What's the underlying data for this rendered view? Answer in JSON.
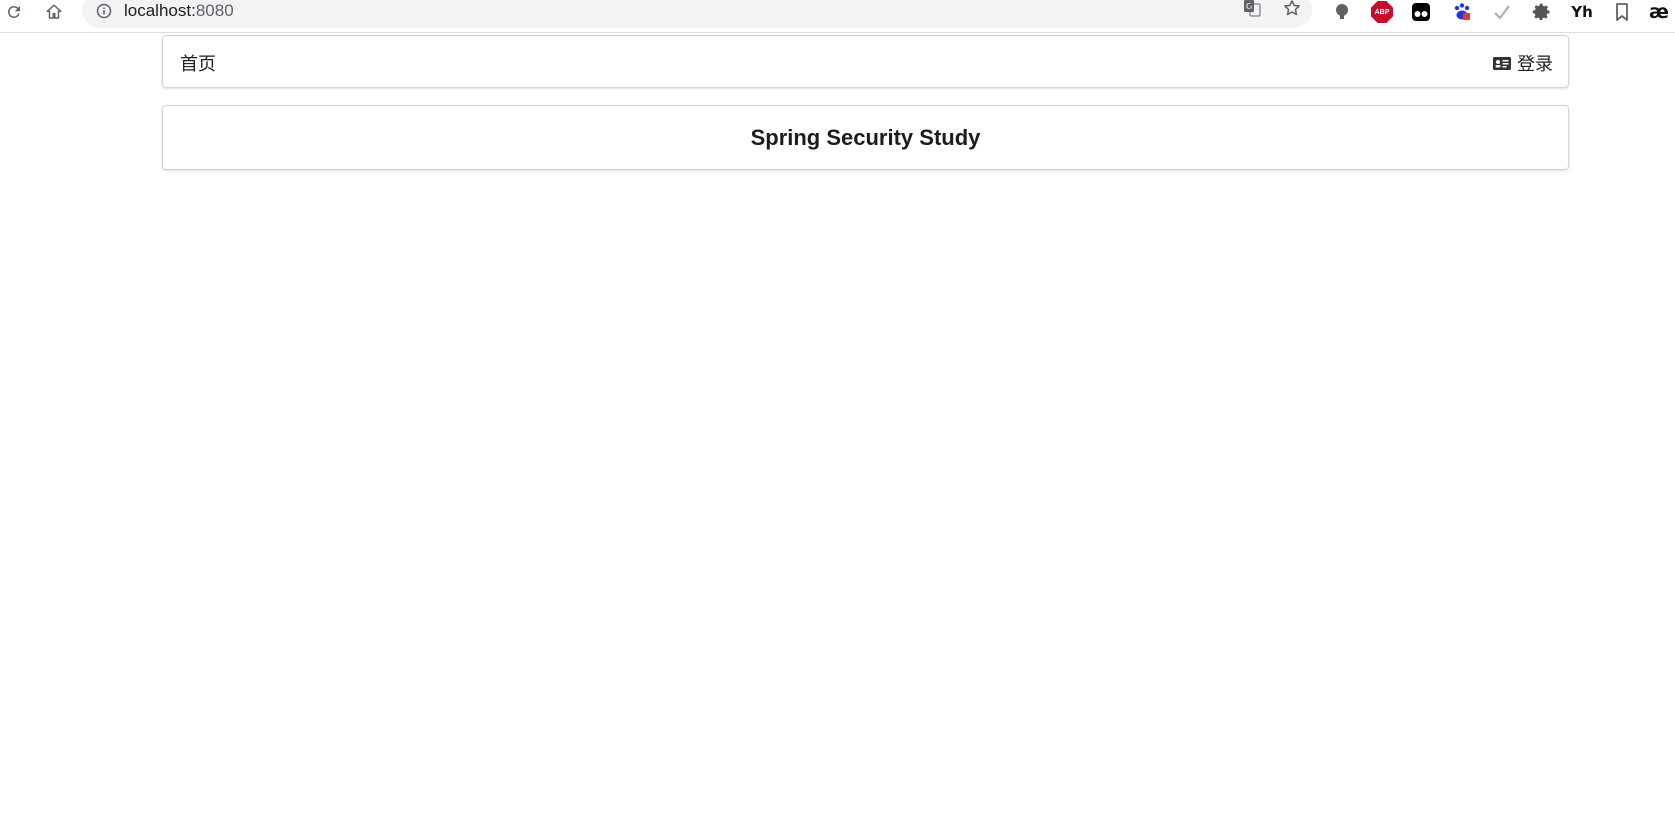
{
  "browser": {
    "url_host": "localhost:",
    "url_port": "8080",
    "extensions": [
      "translate-icon",
      "bookmark-star-icon",
      "lightbulb-icon",
      "adblock-plus-icon",
      "tampermonkey-icon",
      "baidu-paw-icon",
      "check-icon",
      "gear-icon",
      "yh-icon",
      "bookmark-icon",
      "ae-icon"
    ],
    "abp_label": "ABP",
    "yh_label": "Yh",
    "ae_label": "æ"
  },
  "menu": {
    "home_label": "首页",
    "login_label": "登录"
  },
  "main": {
    "title": "Spring Security Study"
  }
}
